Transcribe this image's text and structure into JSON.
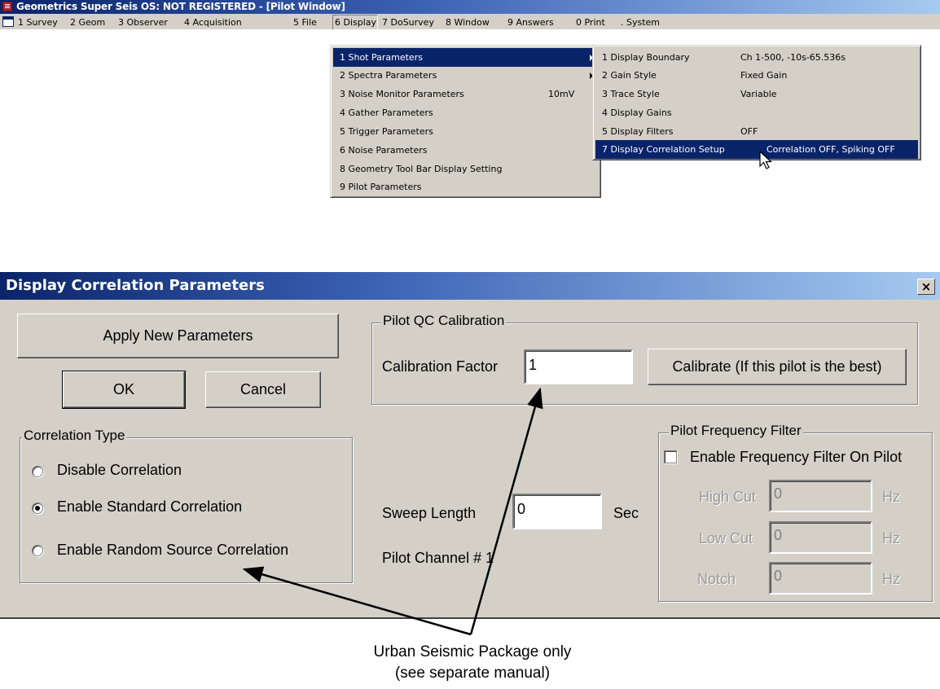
{
  "window": {
    "title": "Geometrics Super Seis OS: NOT REGISTERED - [Pilot Window]"
  },
  "menubar": [
    "1 Survey",
    "2 Geom",
    "3 Observer",
    "4 Acquisition",
    "5 File",
    "6 Display",
    "7 DoSurvey",
    "8 Window",
    "9 Answers",
    "0 Print",
    ". System"
  ],
  "display_menu": [
    {
      "label": "1 Shot Parameters",
      "value": "",
      "submenu": true,
      "highlighted": true
    },
    {
      "label": "2 Spectra Parameters",
      "value": "",
      "submenu": true
    },
    {
      "label": "3 Noise Monitor Parameters",
      "value": "10mV"
    },
    {
      "label": "4 Gather Parameters",
      "value": ""
    },
    {
      "label": "5 Trigger Parameters",
      "value": ""
    },
    {
      "label": "6 Noise Parameters",
      "value": ""
    },
    {
      "label": "8 Geometry Tool Bar Display Setting",
      "value": ""
    },
    {
      "label": "9 Pilot Parameters",
      "value": ""
    }
  ],
  "shot_submenu": [
    {
      "label": "1 Display Boundary",
      "value": "Ch 1-500, -10s-65.536s"
    },
    {
      "label": "2 Gain Style",
      "value": "Fixed Gain"
    },
    {
      "label": "3 Trace Style",
      "value": "Variable"
    },
    {
      "label": "4 Display Gains",
      "value": ""
    },
    {
      "label": "5 Display Filters",
      "value": "OFF"
    },
    {
      "label": "7 Display Correlation Setup",
      "value": "Correlation OFF, Spiking OFF",
      "highlighted": true
    }
  ],
  "dialog": {
    "title": "Display Correlation Parameters",
    "close_glyph": "×",
    "apply_label": "Apply New Parameters",
    "ok_label": "OK",
    "cancel_label": "Cancel",
    "correlation_type": {
      "title": "Correlation  Type",
      "options": [
        "Disable Correlation",
        "Enable Standard Correlation",
        "Enable Random Source Correlation"
      ],
      "selected": "Enable Standard Correlation"
    },
    "pilot_qc": {
      "title": "Pilot QC Calibration",
      "factor_label": "Calibration Factor",
      "factor_value": "1",
      "calibrate_label": "Calibrate (If this pilot is the best)"
    },
    "sweep_length_label": "Sweep Length",
    "sweep_length_value": "0",
    "sweep_length_unit": "Sec",
    "pilot_channel_text": "Pilot Channel # 1",
    "pilot_filter": {
      "title": "Pilot Frequency Filter",
      "enable_label": "Enable Frequency Filter On Pilot",
      "enabled": false,
      "high_cut_label": "High Cut",
      "high_cut_value": "0",
      "low_cut_label": "Low Cut",
      "low_cut_value": "0",
      "notch_label": "Notch",
      "notch_value": "0",
      "unit": "Hz"
    }
  },
  "annotation": {
    "line1": "Urban Seismic Package only",
    "line2": "(see separate manual)"
  }
}
